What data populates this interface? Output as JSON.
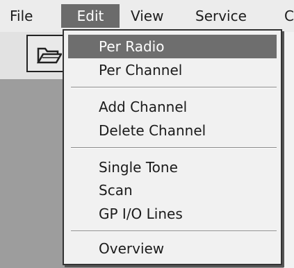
{
  "menubar": {
    "items": [
      "File",
      "Edit",
      "View",
      "Service",
      "C"
    ],
    "active": "Edit"
  },
  "toolbar": {
    "icons": [
      "folder-open-icon"
    ]
  },
  "edit_menu": {
    "items": [
      {
        "label": "Per Radio",
        "selected": true
      },
      {
        "label": "Per Channel"
      },
      {
        "label": "Add Channel"
      },
      {
        "label": "Delete Channel"
      },
      {
        "label": "Single Tone"
      },
      {
        "label": "Scan"
      },
      {
        "label": "GP I/O Lines"
      },
      {
        "label": "Overview"
      }
    ]
  },
  "colors": {
    "highlight": "#6e6e6e",
    "menu_bg": "#f1f1f1",
    "workspace": "#9d9d9d"
  }
}
